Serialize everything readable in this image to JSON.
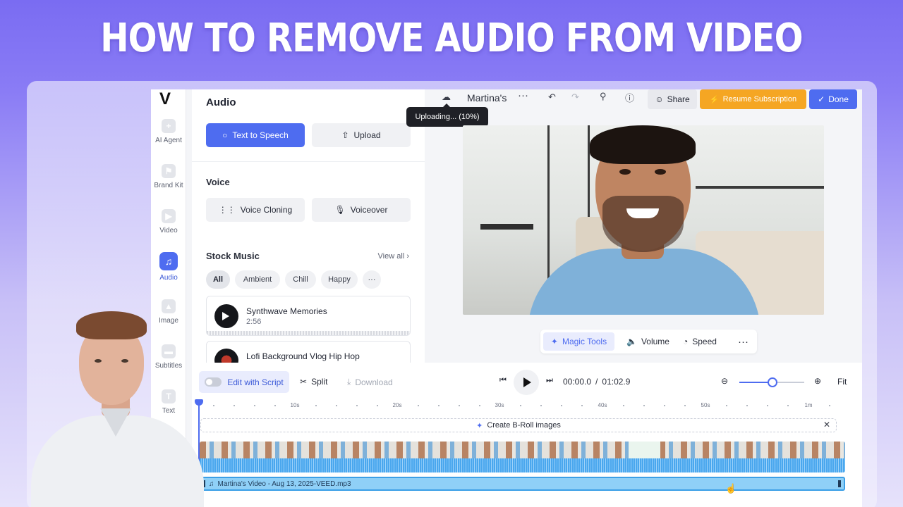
{
  "headline": "HOW TO REMOVE AUDIO FROM VIDEO",
  "colors": {
    "accent": "#4e6cf0",
    "resume": "#f5a623",
    "waveform": "#4aa7ee"
  },
  "app": {
    "logo": "V",
    "project_title": "Martina's",
    "upload_tooltip": "Uploading... (10%)",
    "upload_progress_percent": 10,
    "share_label": "Share",
    "resume_label": "Resume Subscription",
    "done_label": "Done"
  },
  "rail": [
    {
      "label": "AI Agent",
      "icon": "plus-icon"
    },
    {
      "label": "Brand Kit",
      "icon": "brand-kit-icon"
    },
    {
      "label": "Video",
      "icon": "video-icon"
    },
    {
      "label": "Audio",
      "icon": "music-note-icon",
      "active": true
    },
    {
      "label": "Image",
      "icon": "image-icon"
    },
    {
      "label": "Subtitles",
      "icon": "subtitles-icon"
    },
    {
      "label": "Text",
      "icon": "text-icon"
    }
  ],
  "panel": {
    "title": "Audio",
    "text_to_speech": "Text to Speech",
    "upload": "Upload",
    "voice_title": "Voice",
    "voice_cloning": "Voice Cloning",
    "voiceover": "Voiceover",
    "stock_music_title": "Stock Music",
    "view_all": "View all",
    "chips": [
      "All",
      "Ambient",
      "Chill",
      "Happy"
    ],
    "tracks": [
      {
        "name": "Synthwave Memories",
        "duration": "2:56"
      },
      {
        "name": "Lofi Background Vlog Hip Hop",
        "duration": ""
      }
    ]
  },
  "magic_bar": {
    "magic_tools": "Magic Tools",
    "volume": "Volume",
    "speed": "Speed"
  },
  "timeline": {
    "edit_with_script": "Edit with Script",
    "split": "Split",
    "download": "Download",
    "current_time": "00:00.0",
    "separator": "/",
    "total_time": "01:02.9",
    "fit": "Fit",
    "ruler_labels": [
      "10s",
      "20s",
      "30s",
      "40s",
      "50s",
      "1m"
    ],
    "broll_label": "Create B-Roll images",
    "audio_track_name": "Martina's Video - Aug 13, 2025-VEED.mp3"
  }
}
